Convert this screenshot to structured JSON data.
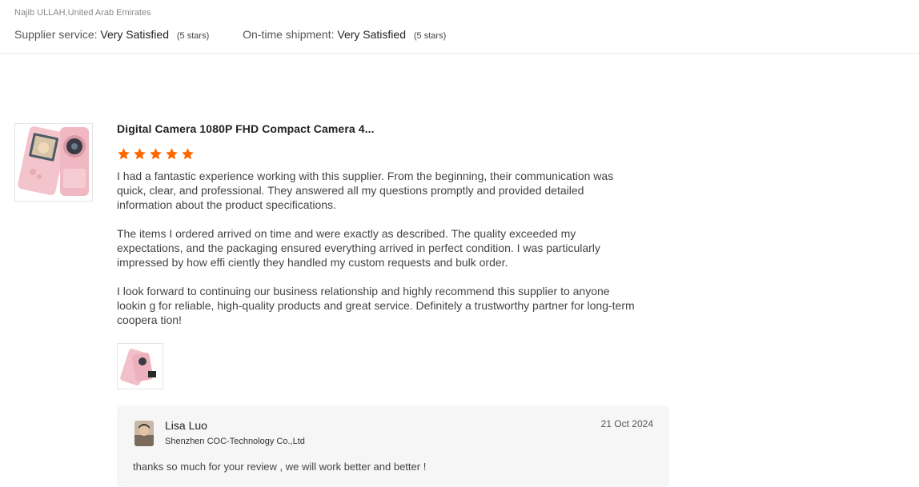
{
  "reviewer": {
    "name_location": "Najib ULLAH,United Arab Emirates"
  },
  "ratings": [
    {
      "label": "Supplier service:",
      "value": "Very Satisfied",
      "stars": "(5 stars)"
    },
    {
      "label": "On-time shipment:",
      "value": "Very Satisfied",
      "stars": "(5 stars)"
    }
  ],
  "review": {
    "product_title": "Digital Camera 1080P FHD Compact Camera 4...",
    "rating": 5,
    "paragraphs": [
      "I had a fantastic experience working with this supplier. From the beginning, their communication was quick, clear, and professional. They answered all my questions promptly and provided detailed information about the product specifications.",
      "The items I ordered arrived on time and were exactly as described. The quality exceeded my expectations, and the packaging ensured everything arrived in perfect condition. I was particularly impressed by how effi ciently they handled my custom requests and bulk order.",
      "I look forward to continuing our business relationship and highly recommend this supplier to anyone lookin g for reliable, high-quality products and great service. Definitely a trustworthy partner for long-term coopera tion!"
    ]
  },
  "reply": {
    "name": "Lisa Luo",
    "company": "Shenzhen COC-Technology Co.,Ltd",
    "date": "21 Oct 2024",
    "text": "thanks so much for your review , we will work better and better !"
  },
  "colors": {
    "star": "#ff6600",
    "reply_bg": "#f6f6f6",
    "divider": "#e6e6e6"
  }
}
